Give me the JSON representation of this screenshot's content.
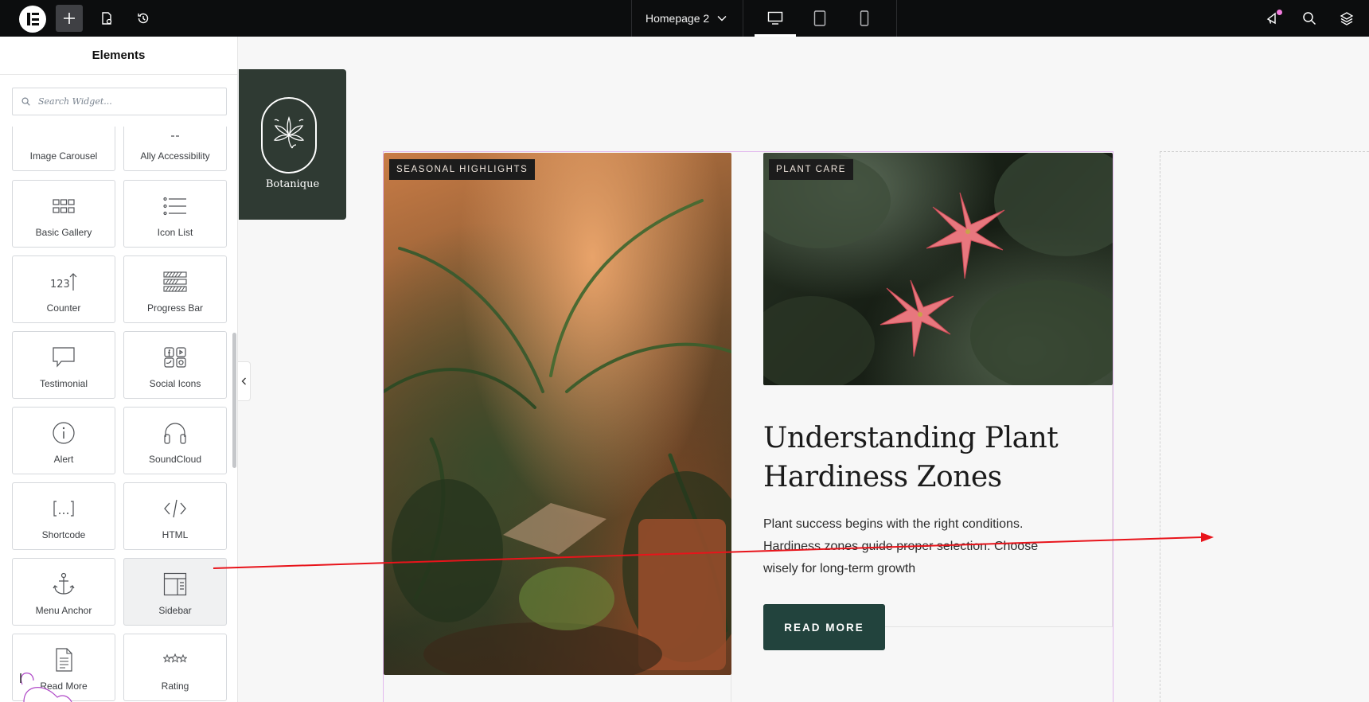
{
  "topbar": {
    "page_selector": "Homepage 2",
    "devices": [
      "desktop",
      "tablet",
      "mobile"
    ],
    "active_device": "desktop"
  },
  "panel": {
    "title": "Elements",
    "search_placeholder": "Search Widget...",
    "widgets": [
      {
        "label": "Image Carousel",
        "icon": "image-carousel-icon"
      },
      {
        "label": "Ally Accessibility",
        "icon": "accessibility-icon"
      },
      {
        "label": "Basic Gallery",
        "icon": "gallery-grid-icon"
      },
      {
        "label": "Icon List",
        "icon": "icon-list-icon"
      },
      {
        "label": "Counter",
        "icon": "counter-icon"
      },
      {
        "label": "Progress Bar",
        "icon": "progress-bar-icon"
      },
      {
        "label": "Testimonial",
        "icon": "speech-bubble-icon"
      },
      {
        "label": "Social Icons",
        "icon": "social-icons-icon"
      },
      {
        "label": "Alert",
        "icon": "info-circle-icon"
      },
      {
        "label": "SoundCloud",
        "icon": "headphones-icon"
      },
      {
        "label": "Shortcode",
        "icon": "shortcode-icon"
      },
      {
        "label": "HTML",
        "icon": "code-icon"
      },
      {
        "label": "Menu Anchor",
        "icon": "anchor-icon"
      },
      {
        "label": "Sidebar",
        "icon": "sidebar-icon"
      },
      {
        "label": "Read More",
        "icon": "document-icon"
      },
      {
        "label": "Rating",
        "icon": "stars-icon"
      }
    ]
  },
  "canvas": {
    "logo_text": "Botanique",
    "tag_left": "SEASONAL HIGHLIGHTS",
    "tag_right": "PLANT CARE",
    "post_title": "Understanding Plant Hardiness Zones",
    "post_excerpt": "Plant success begins with the right conditions. Hardiness zones guide proper selection. Choose wisely for long-term growth",
    "read_more": "READ MORE"
  },
  "colors": {
    "accent_button": "#22433d",
    "logo_card": "#2f3a33",
    "selection_outline": "#e2b8ee",
    "drag_arrow": "#e8141b"
  }
}
